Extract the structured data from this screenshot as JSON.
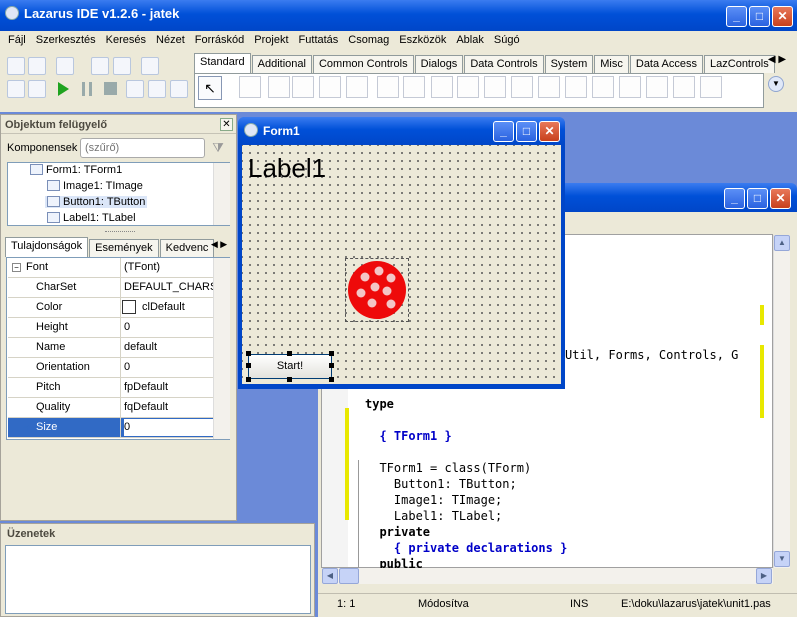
{
  "app": {
    "title": "Lazarus IDE v1.2.6 - jatek"
  },
  "menu": [
    "Fájl",
    "Szerkesztés",
    "Keresés",
    "Nézet",
    "Forráskód",
    "Projekt",
    "Futtatás",
    "Csomag",
    "Eszközök",
    "Ablak",
    "Súgó"
  ],
  "palette_tabs": [
    "Standard",
    "Additional",
    "Common Controls",
    "Dialogs",
    "Data Controls",
    "System",
    "Misc",
    "Data Access",
    "LazControls"
  ],
  "inspector": {
    "title": "Objektum felügyelő",
    "components_label": "Komponensek",
    "filter_placeholder": "(szűrő)",
    "tree": [
      "Form1: TForm1",
      "Image1: TImage",
      "Button1: TButton",
      "Label1: TLabel"
    ],
    "tabs": [
      "Tulajdonságok",
      "Események",
      "Kedvenc"
    ],
    "props": [
      {
        "name": "Font",
        "value": "(TFont)"
      },
      {
        "name": "CharSet",
        "value": "DEFAULT_CHARSET"
      },
      {
        "name": "Color",
        "value": "clDefault"
      },
      {
        "name": "Height",
        "value": "0"
      },
      {
        "name": "Name",
        "value": "default"
      },
      {
        "name": "Orientation",
        "value": "0"
      },
      {
        "name": "Pitch",
        "value": "fpDefault"
      },
      {
        "name": "Quality",
        "value": "fqDefault"
      },
      {
        "name": "Size",
        "value": "0"
      }
    ]
  },
  "messages": {
    "title": "Üzenetek"
  },
  "form": {
    "title": "Form1",
    "label": "Label1",
    "button": "Start!"
  },
  "editor": {
    "lines": [
      {
        "text": "Util, Forms, Controls, G",
        "style": "plain"
      },
      {
        "text": "type",
        "style": "kw"
      },
      {
        "text": "  { TForm1 }",
        "style": "cm"
      },
      {
        "text": "  TForm1 = class(TForm)",
        "style": "plain"
      },
      {
        "text": "    Button1: TButton;",
        "style": "plain"
      },
      {
        "text": "    Image1: TImage;",
        "style": "plain"
      },
      {
        "text": "    Label1: TLabel;",
        "style": "plain"
      },
      {
        "text": "  private",
        "style": "kw"
      },
      {
        "text": "    { private declarations }",
        "style": "cm"
      },
      {
        "text": "  public",
        "style": "kw"
      }
    ],
    "status": {
      "pos": "1:  1",
      "modified": "Módosítva",
      "mode": "INS",
      "file": "E:\\doku\\lazarus\\jatek\\unit1.pas"
    }
  }
}
